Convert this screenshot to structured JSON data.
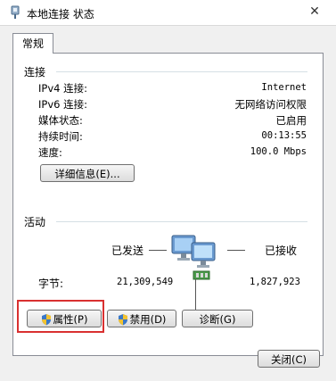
{
  "window": {
    "title": "本地连接 状态",
    "close_glyph": "✕",
    "icons": [
      "network-adapter-icon",
      "close-icon"
    ]
  },
  "tab": {
    "label": "常规"
  },
  "connection": {
    "title": "连接",
    "rows": [
      {
        "label": "IPv4 连接:",
        "value": "Internet"
      },
      {
        "label": "IPv6 连接:",
        "value": "无网络访问权限"
      },
      {
        "label": "媒体状态:",
        "value": "已启用"
      },
      {
        "label": "持续时间:",
        "value": "00:13:55"
      },
      {
        "label": "速度:",
        "value": "100.0 Mbps"
      }
    ],
    "details_button": "详细信息(E)..."
  },
  "activity": {
    "title": "活动",
    "sent_label": "已发送",
    "received_label": "已接收",
    "bytes_label": "字节:",
    "sent_bytes": "21,309,549",
    "received_bytes": "1,827,923",
    "icon": "network-computers-icon"
  },
  "buttons": {
    "properties": "属性(P)",
    "disable": "禁用(D)",
    "diagnose": "诊断(G)",
    "close": "关闭(C)"
  },
  "colors": {
    "highlight": "#d93030",
    "panel_border": "#898c95",
    "separator": "#d5dfe5"
  }
}
